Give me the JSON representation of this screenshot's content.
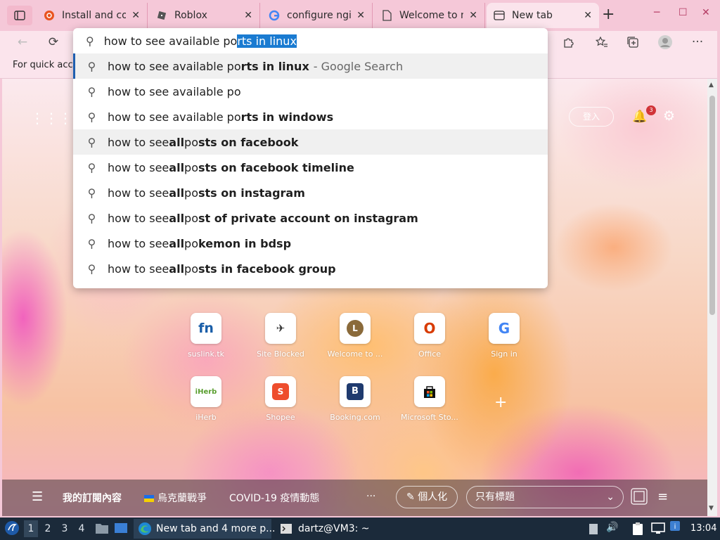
{
  "tabs": [
    {
      "title": "Install and cor",
      "icon": "ubuntu-icon"
    },
    {
      "title": "Roblox",
      "icon": "roblox-icon"
    },
    {
      "title": "configure ngin",
      "icon": "google-icon"
    },
    {
      "title": "Welcome to n",
      "icon": "document-icon"
    },
    {
      "title": "New tab",
      "icon": "newtab-icon",
      "active": true
    }
  ],
  "favorites_bar": {
    "text": "For quick acc"
  },
  "omnibox": {
    "typed": "how to see available po",
    "autocomplete": "rts in linux",
    "suggestions": [
      {
        "pre": "how to see available po",
        "bold": "rts in linux",
        "post": "",
        "suffix": " - Google Search"
      },
      {
        "pre": "how to see available po",
        "bold": "",
        "post": "",
        "suffix": ""
      },
      {
        "pre": "how to see available po",
        "bold": "rts in windows",
        "post": "",
        "suffix": ""
      },
      {
        "pre": "how to see ",
        "bold": "all",
        "post": " po",
        "bold2": "sts on facebook",
        "suffix": ""
      },
      {
        "pre": "how to see ",
        "bold": "all",
        "post": " po",
        "bold2": "sts on facebook timeline",
        "suffix": ""
      },
      {
        "pre": "how to see ",
        "bold": "all",
        "post": " po",
        "bold2": "sts on instagram",
        "suffix": ""
      },
      {
        "pre": "how to see ",
        "bold": "all",
        "post": " po",
        "bold2": "st of private account on instagram",
        "suffix": ""
      },
      {
        "pre": "how to see ",
        "bold": "all",
        "post": " po",
        "bold2": "kemon in bdsp",
        "suffix": ""
      },
      {
        "pre": "how to see ",
        "bold": "all",
        "post": " po",
        "bold2": "sts in facebook group",
        "suffix": ""
      }
    ]
  },
  "ntp": {
    "sign_in": "登入",
    "notification_count": "3",
    "tiles": [
      {
        "label": "suslink.tk",
        "glyph": "fn",
        "color": "#1a5ea8"
      },
      {
        "label": "Site Blocked",
        "glyph": "✈",
        "color": "#333333"
      },
      {
        "label": "Welcome to ...",
        "glyph": "L",
        "color": "#8a6a3a"
      },
      {
        "label": "Office",
        "glyph": "O",
        "color": "#d83b01"
      },
      {
        "label": "Sign in",
        "glyph": "G",
        "color": "#4285f4"
      },
      {
        "label": "iHerb",
        "glyph": "iHerb",
        "color": "#5a9e2f"
      },
      {
        "label": "Shopee",
        "glyph": "🛍",
        "color": "#ee4d2d"
      },
      {
        "label": "Booking.com",
        "glyph": "B",
        "color": "#ffffff"
      },
      {
        "label": "Microsoft Sto...",
        "glyph": "▦",
        "color": "#111111"
      }
    ],
    "newsbar": {
      "my_feed": "我的訂閱內容",
      "ukraine": "烏克蘭戰爭",
      "covid": "COVID-19 疫情動態",
      "more": "···",
      "personalize": "個人化",
      "view_select": "只有標題"
    }
  },
  "taskbar": {
    "workspaces": [
      "1",
      "2",
      "3",
      "4"
    ],
    "active_app": "New tab and 4 more p...",
    "terminal": "dartz@VM3: ~",
    "clock": "13:04"
  }
}
